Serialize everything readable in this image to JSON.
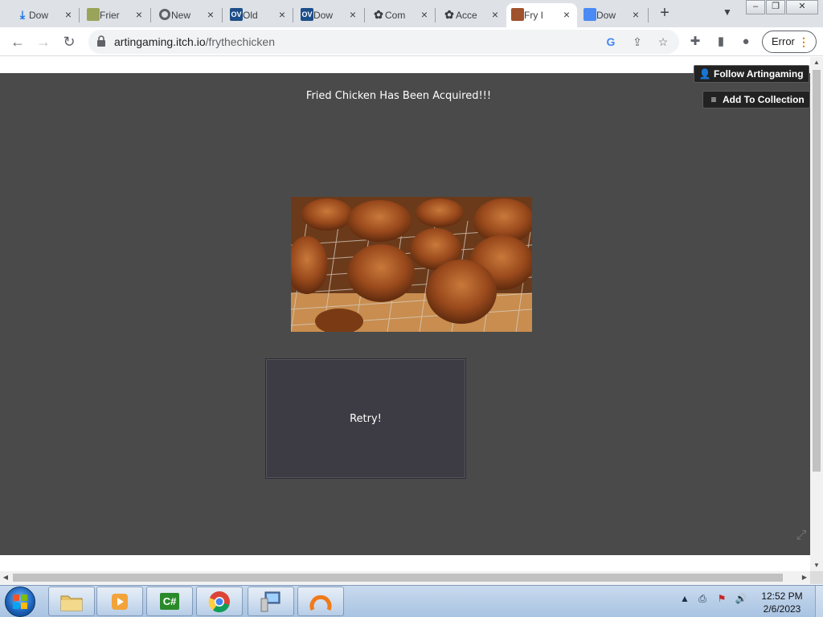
{
  "tabs": [
    {
      "title": "Dow",
      "icon": "download-icon",
      "color": "#1a73e8"
    },
    {
      "title": "Frier",
      "icon": "game-favicon",
      "color": "#6b8e23"
    },
    {
      "title": "New",
      "icon": "chrome-icon",
      "color": "#5f6368"
    },
    {
      "title": "Old",
      "icon": "ov-icon",
      "color": "#1d4e89"
    },
    {
      "title": "Dow",
      "icon": "ov-icon",
      "color": "#1d4e89"
    },
    {
      "title": "Com",
      "icon": "openai-icon",
      "color": "#3c4043"
    },
    {
      "title": "Acce",
      "icon": "openai-icon",
      "color": "#3c4043"
    },
    {
      "title": "Fry I",
      "icon": "chicken-favicon",
      "color": "#a0522d"
    },
    {
      "title": "Dow",
      "icon": "download-page-icon",
      "color": "#1a73e8"
    }
  ],
  "ov_label": "OV",
  "toolbar": {
    "url_host": "artingaming.itch.io",
    "url_path": "/frythechicken",
    "profile_error": "Error"
  },
  "game": {
    "message": "Fried Chicken Has Been Acquired!!!",
    "retry_label": "Retry!"
  },
  "itch": {
    "follow_label": "Follow Artingaming",
    "collection_label": "Add To Collection"
  },
  "taskbar": {
    "time": "12:52 PM",
    "date": "2/6/2023",
    "csharp_label": "C#"
  }
}
